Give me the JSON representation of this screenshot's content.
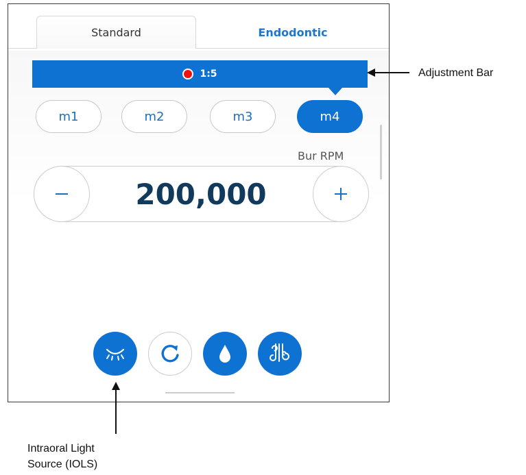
{
  "tabs": [
    {
      "label": "Standard",
      "selected": true
    },
    {
      "label": "Endodontic",
      "selected": false
    }
  ],
  "adjustment_bar": {
    "ratio": "1:5",
    "indicator_color": "#ee1111"
  },
  "memory_buttons": [
    {
      "label": "m1",
      "active": false
    },
    {
      "label": "m2",
      "active": false
    },
    {
      "label": "m3",
      "active": false
    },
    {
      "label": "m4",
      "active": true
    }
  ],
  "speed": {
    "label": "Bur RPM",
    "value": "200,000"
  },
  "function_buttons": [
    {
      "icon": "light-icon",
      "active": true
    },
    {
      "icon": "rotation-icon",
      "active": false
    },
    {
      "icon": "water-drop-icon",
      "active": true
    },
    {
      "icon": "air-spray-icon",
      "active": true
    }
  ],
  "callouts": {
    "adjustment_bar": "Adjustment Bar",
    "iols_line1": "Intraoral Light",
    "iols_line2": "Source (IOLS)"
  },
  "colors": {
    "accent": "#0d72d1",
    "text_dark": "#123a5c",
    "border": "#cccccc"
  }
}
